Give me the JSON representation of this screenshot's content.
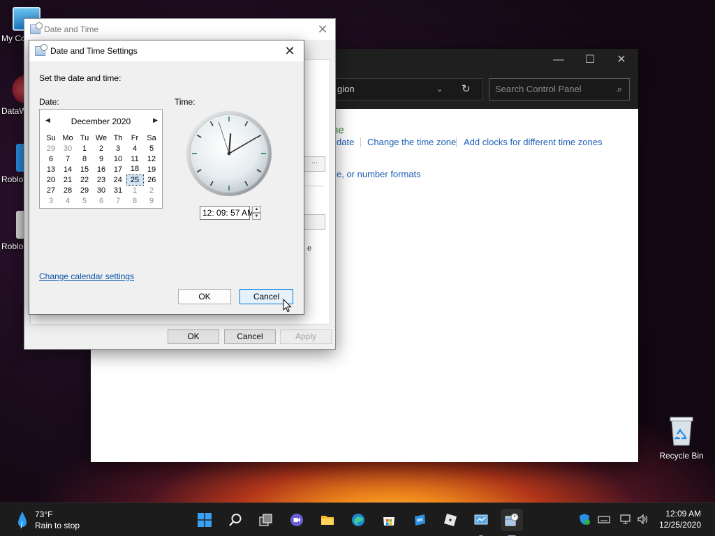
{
  "desktop": {
    "icons": [
      {
        "label": "My Co"
      },
      {
        "label": "DataW"
      },
      {
        "label": "Roblo"
      },
      {
        "label": "Roblo"
      }
    ],
    "recycle_bin": "Recycle Bin"
  },
  "control_panel": {
    "address_text": "gion",
    "search_placeholder": "Search Control Panel",
    "heading_fragment": "ne",
    "links": [
      "date",
      "Change the time zone",
      "Add clocks for different time zones"
    ],
    "link2": "e, or number formats",
    "caption": {
      "minimize": "—",
      "maximize": "☐",
      "close": "✕"
    }
  },
  "date_time_dialog": {
    "title": "Date and Time",
    "close": "✕",
    "partial_button": "...",
    "partial_text": "e",
    "buttons": {
      "ok": "OK",
      "cancel": "Cancel",
      "apply": "Apply"
    }
  },
  "settings_dialog": {
    "title": "Date and Time Settings",
    "close": "✕",
    "instruction": "Set the date and time:",
    "date_label": "Date:",
    "time_label": "Time:",
    "calendar": {
      "month": "December 2020",
      "prev": "◀",
      "next": "▶",
      "weekdays": [
        "Su",
        "Mo",
        "Tu",
        "We",
        "Th",
        "Fr",
        "Sa"
      ],
      "weeks": [
        [
          "29",
          "30",
          "1",
          "2",
          "3",
          "4",
          "5"
        ],
        [
          "6",
          "7",
          "8",
          "9",
          "10",
          "11",
          "12"
        ],
        [
          "13",
          "14",
          "15",
          "16",
          "17",
          "18",
          "19"
        ],
        [
          "20",
          "21",
          "22",
          "23",
          "24",
          "25",
          "26"
        ],
        [
          "27",
          "28",
          "29",
          "30",
          "31",
          "1",
          "2"
        ],
        [
          "3",
          "4",
          "5",
          "6",
          "7",
          "8",
          "9"
        ]
      ],
      "selected_day": "25"
    },
    "clock": {
      "hour": 12,
      "minute": 9,
      "second": 57
    },
    "time_value": "12: 09: 57 AM",
    "spin_up": "▲",
    "spin_down": "▼",
    "calendar_link": "Change calendar settings",
    "buttons": {
      "ok": "OK",
      "cancel": "Cancel"
    }
  },
  "taskbar": {
    "weather_temp": "73°F",
    "weather_desc": "Rain to stop",
    "time": "12:09 AM",
    "date": "12/25/2020",
    "apps": [
      "start-icon",
      "search-icon",
      "task-view-icon",
      "chat-icon",
      "file-explorer-icon",
      "edge-icon",
      "store-icon",
      "app-icon-blue",
      "roblox-icon",
      "control-panel-icon",
      "date-time-icon"
    ],
    "tray": [
      "security-icon",
      "keyboard-icon",
      "network-icon",
      "volume-icon"
    ]
  },
  "colors": {
    "link": "#1a5fb4",
    "accent": "#0078d7",
    "taskbar": "#1c1c1c"
  }
}
